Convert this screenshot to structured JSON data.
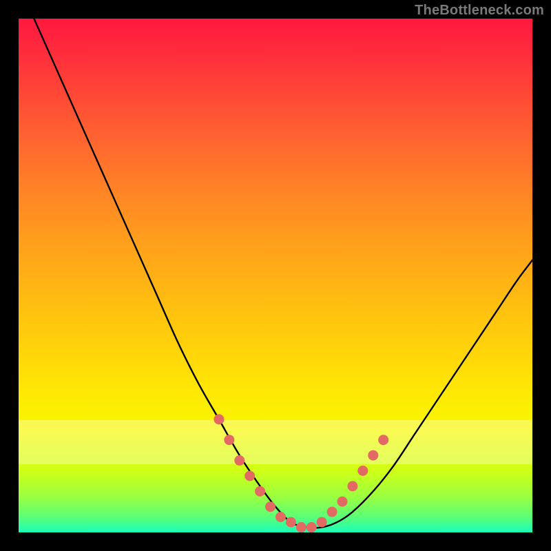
{
  "watermark": "TheBottleneck.com",
  "chart_data": {
    "type": "line",
    "title": "",
    "xlabel": "",
    "ylabel": "",
    "xlim": [
      0,
      100
    ],
    "ylim": [
      0,
      100
    ],
    "grid": false,
    "highlight_band_y": [
      9.5,
      18.5
    ],
    "series": [
      {
        "name": "bottleneck-curve",
        "color": "#000000",
        "x": [
          3,
          7,
          11,
          15,
          19,
          23,
          27,
          31,
          35,
          39,
          43,
          47,
          50,
          53,
          56,
          59,
          62,
          65,
          69,
          73,
          77,
          81,
          85,
          89,
          93,
          97,
          100
        ],
        "y": [
          100,
          91,
          82,
          73,
          64,
          55,
          46,
          37,
          29,
          22,
          15,
          9,
          5,
          2,
          1,
          1,
          2,
          4,
          8,
          13,
          19,
          25,
          31,
          37,
          43,
          49,
          53
        ]
      },
      {
        "name": "curve-markers",
        "type": "scatter",
        "color": "#e36a63",
        "x": [
          39,
          41,
          43,
          45,
          47,
          49,
          51,
          53,
          55,
          57,
          59,
          61,
          63,
          65,
          67,
          69,
          71
        ],
        "y": [
          22,
          18,
          14,
          11,
          8,
          5,
          3,
          2,
          1,
          1,
          2,
          4,
          6,
          9,
          12,
          15,
          18
        ]
      }
    ]
  }
}
